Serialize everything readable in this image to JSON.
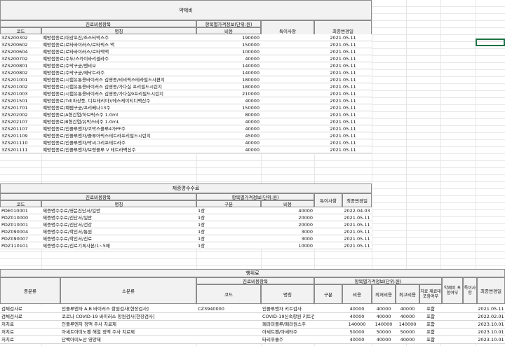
{
  "colors": {
    "header_bg": "#f2f2f2",
    "border": "#8c8c8c",
    "grid": "#e6e6e6",
    "selection": "#1e7145"
  },
  "t1": {
    "title": "약제비",
    "group_header": "진료비용항목",
    "price_header": "항목별가격정보(단위:원)",
    "col_code": "코드",
    "col_name": "명칭",
    "col_cost": "비용",
    "col_note": "특이사항",
    "col_date": "최종변경일",
    "rows": [
      {
        "code": "3ZS200302",
        "name": "예방접종료/대상포진/조스터박스주",
        "cost": "190000",
        "date": "2021.05.11"
      },
      {
        "code": "3ZS200602",
        "name": "예방접종료/로타바이러스/로타릭스 액",
        "cost": "150000",
        "date": "2021.05.11"
      },
      {
        "code": "3ZS200604",
        "name": "예방접종료/로타바이러스/로타텍액",
        "cost": "100000",
        "date": "2021.05.11"
      },
      {
        "code": "3ZS200702",
        "name": "예방접종료/수두/스카이바리셀라주",
        "cost": "40000",
        "date": "2021.05.11"
      },
      {
        "code": "3ZS200801",
        "name": "예방접종료/수막구균/멘비오",
        "cost": "140000",
        "date": "2021.05.11"
      },
      {
        "code": "3ZS200802",
        "name": "예방접종료/수막구균/메낙트라주",
        "cost": "140000",
        "date": "2021.05.11"
      },
      {
        "code": "3ZS201001",
        "name": "예방접종료/시험유통용바이러스 김영종/비비릭스테라필드사편지",
        "cost": "180000",
        "date": "2021.05.11"
      },
      {
        "code": "3ZS201002",
        "name": "예방접종료/시험유통용바이러스 김영종/가다실 프리필드시린지",
        "cost": "180000",
        "date": "2021.05.11"
      },
      {
        "code": "3ZS201003",
        "name": "예방접종료/시험유통용바이러스 김영종/가다실9프리필드시린지",
        "cost": "210000",
        "date": "2021.05.11"
      },
      {
        "code": "3ZS201501",
        "name": "예방접종료/Td(파상풍, 디프테리아)/에스케이티디백신주",
        "cost": "40000",
        "date": "2021.05.11"
      },
      {
        "code": "3ZS201701",
        "name": "예방접종료/폐렴구균/프리베나13주",
        "cost": "150000",
        "date": "2021.05.11"
      },
      {
        "code": "3ZS202002",
        "name": "예방접종료/A형간염/하브릭스주 1.0ml",
        "cost": "80000",
        "date": "2021.05.11"
      },
      {
        "code": "3ZS202107",
        "name": "예방접종료/B형간염/유박스비주 1.0mL",
        "cost": "40000",
        "date": "2021.05.11"
      },
      {
        "code": "3ZS201107",
        "name": "예방접종료/인플루엔자/코박스플루4가PF주",
        "cost": "40000",
        "date": "2021.05.11"
      },
      {
        "code": "3ZS201109",
        "name": "예방접종료/인플루엔자/플루아릭스테트라프리필드시린지",
        "cost": "45000",
        "date": "2021.05.11"
      },
      {
        "code": "3ZS201110",
        "name": "예방접종료/인플루엔자/박씨그리프테트라주",
        "cost": "40000",
        "date": "2021.05.11"
      },
      {
        "code": "3ZS201111",
        "name": "예방접종료/인플루엔자/보령플루 V 테트라백신주",
        "cost": "40000",
        "date": "2021.05.11"
      }
    ]
  },
  "t2": {
    "title": "제증명수수료",
    "group_header": "진료비용항목",
    "price_header": "항목별가격정보(단위:원)",
    "col_code": "코드",
    "col_name": "명칭",
    "col_unit": "구분",
    "col_cost": "비용",
    "col_note": "특이사항",
    "col_date": "최종변경일",
    "rows": [
      {
        "code": "PDE010001",
        "name": "제증명수수료/영문진단서/일반",
        "unit": "1장",
        "cost": "40000",
        "date": "2022.04.03"
      },
      {
        "code": "PDZ010000",
        "name": "제증명수수료/진단서/일반",
        "unit": "1장",
        "cost": "20000",
        "date": "2021.05.11"
      },
      {
        "code": "PDZ010001",
        "name": "제증명수수료/진단서/건강",
        "unit": "1장",
        "cost": "20000",
        "date": "2021.05.11"
      },
      {
        "code": "PDZ090004",
        "name": "제증명수수료/학인서/통원",
        "unit": "1장",
        "cost": "3000",
        "date": "2021.05.11"
      },
      {
        "code": "PDZ090007",
        "name": "제증명수수료/학인서/진료",
        "unit": "1장",
        "cost": "3000",
        "date": "2021.05.11"
      },
      {
        "code": "PDZ110101",
        "name": "제증명수수료/진료기록사본/1~5매",
        "unit": "1장",
        "cost": "10000",
        "date": "2021.05.11"
      }
    ]
  },
  "t3": {
    "title": "행위료",
    "group_header": "진료비용항목",
    "price_header": "항목별가격정보(단위:원)",
    "col_major": "중분류",
    "col_minor": "소분류",
    "col_code": "코드",
    "col_name": "명칭",
    "col_unit": "구분",
    "col_cost": "비용",
    "col_min": "최저비용",
    "col_max": "최고비용",
    "col_include": "치료 재료대 포함여부",
    "col_drug": "약제비 포함여부",
    "col_note": "특이사항",
    "col_date": "최종변경일",
    "rows": [
      {
        "major": "검체검사료",
        "minor": "인플루엔자 A,B 바이러스 항원검사[현장검사]",
        "code": "CZ3940000",
        "name": "인플루엔자 키트검사",
        "unit": "",
        "cost": "40000",
        "min": "40000",
        "max": "40000",
        "include": "포함",
        "drug": "",
        "note": "",
        "date": "2021.05.11"
      },
      {
        "major": "검체검사료",
        "minor": "코로나 COVID-19 바이러스 항원검사[현장검사]",
        "code": "",
        "name": "COVID-19신속항원 키트검사",
        "unit": "",
        "cost": "40000",
        "min": "40000",
        "max": "40000",
        "include": "포함",
        "drug": "",
        "note": "",
        "date": "2022.02.01"
      },
      {
        "major": "처치료",
        "minor": "인플루엔자 정맥 주사 치료제",
        "code": "",
        "name": "페라미플루/페라원스주",
        "unit": "",
        "cost": "140000",
        "min": "140000",
        "max": "140000",
        "include": "포함",
        "drug": "",
        "note": "",
        "date": "2023.10.01"
      },
      {
        "major": "처치료",
        "minor": "아세트아미노펜 해열 정맥 주사 치료제",
        "code": "",
        "name": "아세트펜/아세타주",
        "unit": "",
        "cost": "50000",
        "min": "50000",
        "max": "50000",
        "include": "포함",
        "drug": "",
        "note": "",
        "date": "2023.10.01"
      },
      {
        "major": "처치료",
        "minor": "단백아미노산 영양제",
        "code": "",
        "name": "타리푸솔주",
        "unit": "",
        "cost": "40000",
        "min": "40000",
        "max": "40000",
        "include": "포함",
        "drug": "",
        "note": "",
        "date": "2023.10.01"
      }
    ]
  }
}
